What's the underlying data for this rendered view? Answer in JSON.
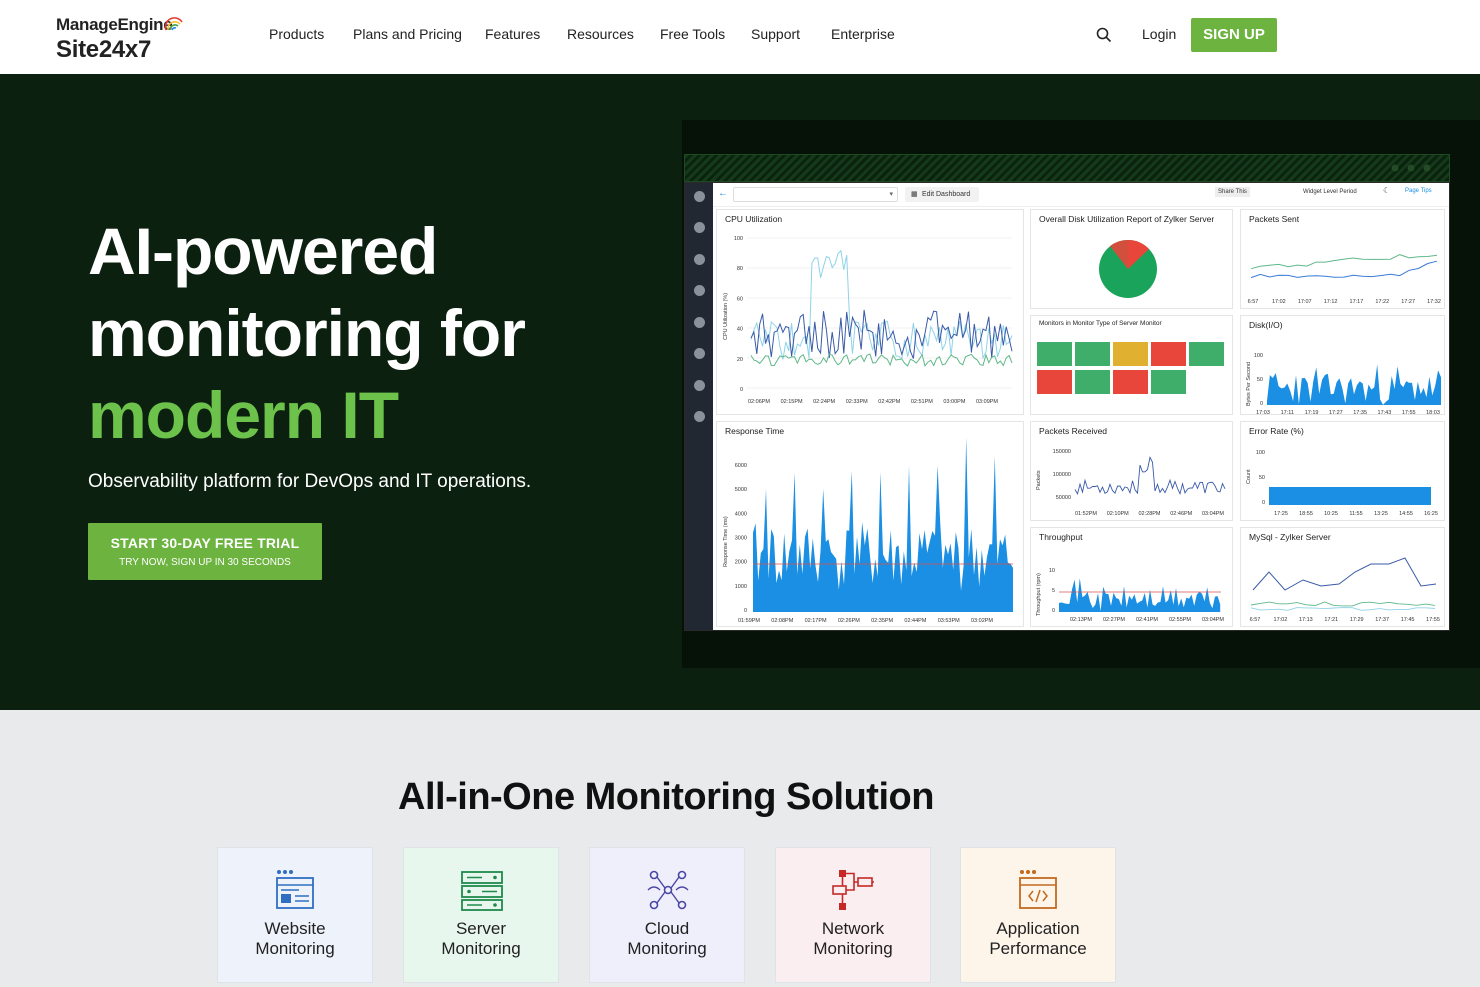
{
  "header": {
    "brand_top": "ManageEngine",
    "brand_bottom": "Site24x7",
    "nav": [
      "Products",
      "Plans and Pricing",
      "Features",
      "Resources",
      "Free Tools",
      "Support",
      "Enterprise"
    ],
    "login": "Login",
    "signup": "SIGN UP"
  },
  "hero": {
    "line1": "AI-powered",
    "line2": "monitoring for",
    "line3": "modern IT",
    "subtitle": "Observability platform for DevOps and IT operations.",
    "cta_main": "START 30-DAY FREE TRIAL",
    "cta_sub": "TRY NOW, SIGN UP IN 30 SECONDS"
  },
  "dashboard": {
    "edit_label": "Edit Dashboard",
    "share_label": "Share This",
    "period_label": "Widget Level Period",
    "tips_label": "Page Tips",
    "panels": {
      "cpu": "CPU Utilization",
      "disk": "Overall Disk Utilization Report of Zylker Server",
      "packets_sent": "Packets Sent",
      "monitors": "Monitors in Monitor Type of Server Monitor",
      "disk_io": "Disk(I/O)",
      "response": "Response Time",
      "packets_received": "Packets Received",
      "error_rate": "Error Rate (%)",
      "throughput": "Throughput",
      "mysql": "MySql - Zylker Server"
    },
    "axis": {
      "cpu_y": "CPU Utilization (%)",
      "cpu_yticks": [
        "100",
        "80",
        "60",
        "40",
        "20",
        "0"
      ],
      "cpu_xticks": [
        "02:06PM",
        "02:15PM",
        "02:24PM",
        "02:33PM",
        "02:42PM",
        "02:51PM",
        "03:00PM",
        "03:09PM"
      ],
      "sent_xticks": [
        "6:57",
        "17:02",
        "17:07",
        "17:12",
        "17:17",
        "17:22",
        "17:27",
        "17:32"
      ],
      "diskio_y": "Bytes Per Second",
      "diskio_yticks": [
        "100",
        "50",
        "0"
      ],
      "diskio_xticks": [
        "17:03",
        "17:11",
        "17:19",
        "17:27",
        "17:35",
        "17:43",
        "17:55",
        "18:03"
      ],
      "resp_y": "Response Time (ms)",
      "resp_yticks": [
        "6000",
        "5000",
        "4000",
        "3000",
        "2000",
        "1000",
        "0"
      ],
      "resp_xticks": [
        "01:59PM",
        "02:08PM",
        "02:17PM",
        "02:26PM",
        "02:35PM",
        "02:44PM",
        "03:53PM",
        "03:02PM"
      ],
      "recv_y": "Packets",
      "recv_yticks": [
        "150000",
        "100000",
        "50000"
      ],
      "recv_xticks": [
        "01:52PM",
        "02:10PM",
        "02:28PM",
        "02:46PM",
        "03:04PM"
      ],
      "err_y": "Count",
      "err_yticks": [
        "100",
        "50",
        "0"
      ],
      "err_xticks": [
        "17:25",
        "18:55",
        "10:25",
        "11:55",
        "13:25",
        "14:55",
        "16:25"
      ],
      "thr_y": "Throughput (rpm)",
      "thr_yticks": [
        "10",
        "5",
        "0"
      ],
      "thr_xticks": [
        "02:13PM",
        "02:27PM",
        "02:41PM",
        "02:55PM",
        "03:04PM"
      ],
      "mysql_xticks": [
        "6:57",
        "17:02",
        "17:13",
        "17:21",
        "17:29",
        "17:37",
        "17:45",
        "17:55"
      ]
    },
    "status_colors": [
      "#3fae6a",
      "#3fae6a",
      "#e0b030",
      "#e8463a",
      "#3fae6a",
      "#e8463a",
      "#3fae6a",
      "#e8463a",
      "#3fae6a"
    ]
  },
  "section": {
    "title": "All-in-One Monitoring Solution",
    "cards": [
      {
        "line1": "Website",
        "line2": "Monitoring",
        "icon": "website-icon",
        "bg": "#eef3fb"
      },
      {
        "line1": "Server",
        "line2": "Monitoring",
        "icon": "server-icon",
        "bg": "#e8f7ee"
      },
      {
        "line1": "Cloud",
        "line2": "Monitoring",
        "icon": "cloud-icon",
        "bg": "#efeefb"
      },
      {
        "line1": "Network",
        "line2": "Monitoring",
        "icon": "network-icon",
        "bg": "#fbeef0"
      },
      {
        "line1": "Application",
        "line2": "Performance",
        "icon": "application-icon",
        "bg": "#fdf4ea"
      }
    ]
  },
  "colors": {
    "brand_green": "#6cb33f",
    "hero_bg": "#0c200f",
    "chart_blue": "#1a8fe3"
  }
}
